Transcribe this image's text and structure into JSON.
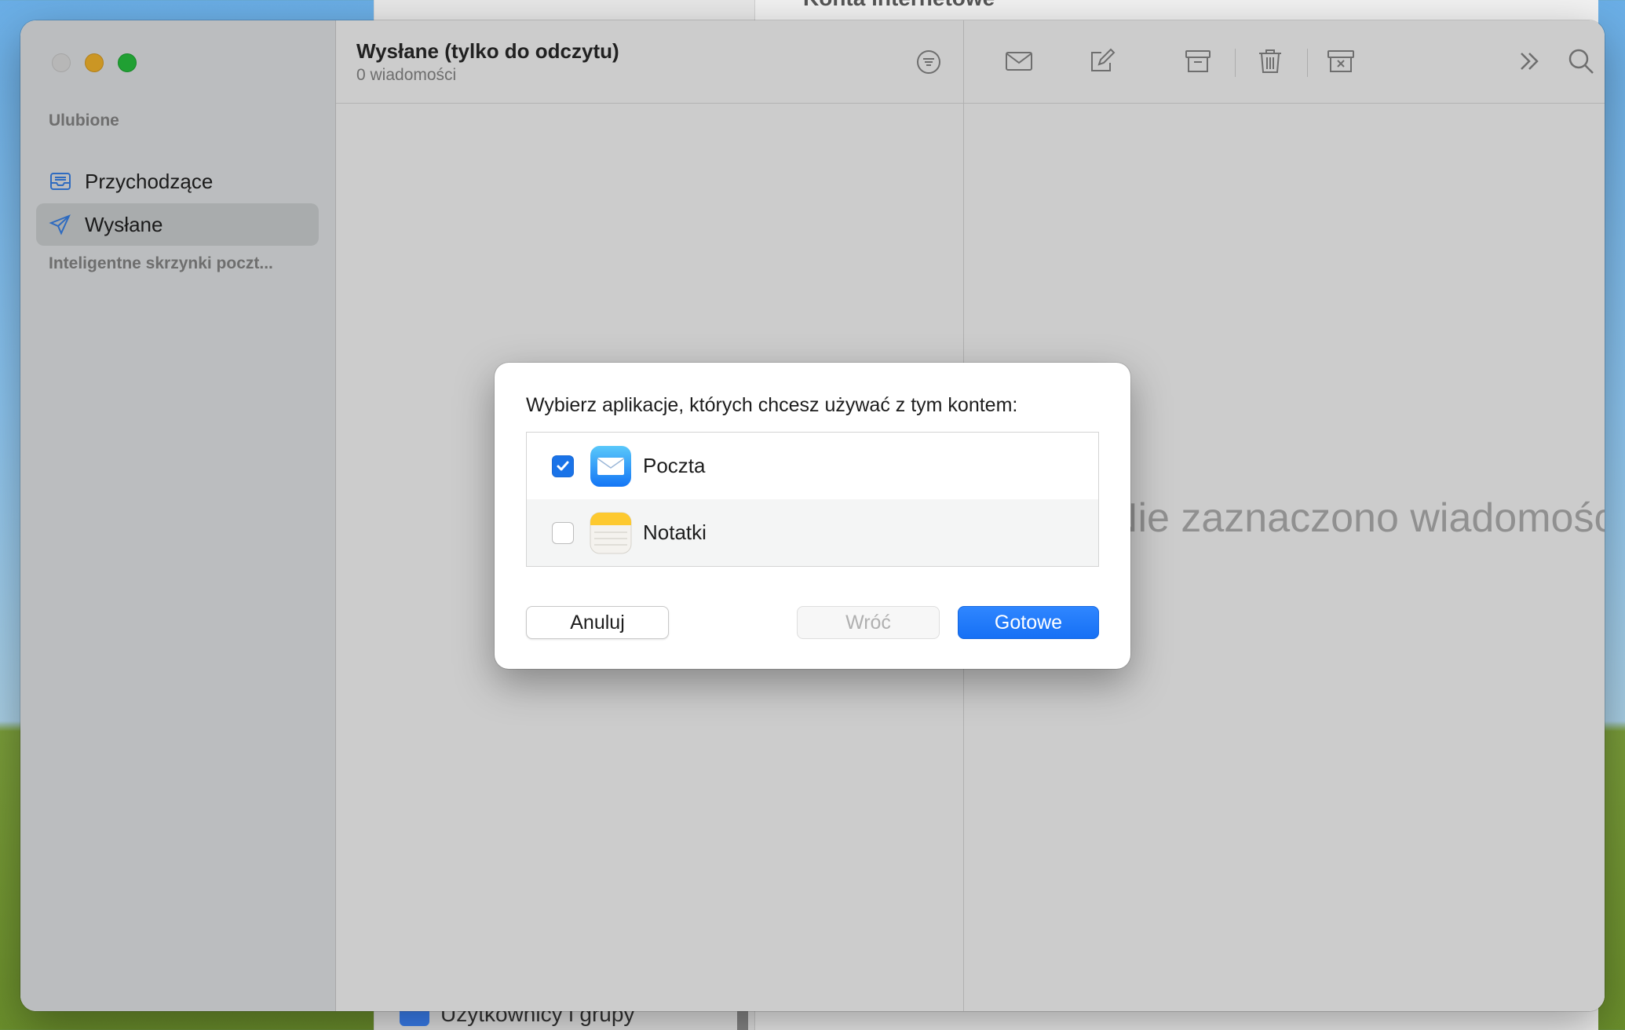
{
  "background_window": {
    "title": "Konta internetowe",
    "bottom_item": "Użytkownicy i grupy"
  },
  "sidebar": {
    "favorites_label": "Ulubione",
    "items": [
      {
        "label": "Przychodzące",
        "icon": "inbox-icon"
      },
      {
        "label": "Wysłane",
        "icon": "paper-plane-icon",
        "selected": true
      }
    ],
    "smart_mailboxes_label": "Inteligentne skrzynki poczt..."
  },
  "message_list": {
    "title": "Wysłane (tylko do odczytu)",
    "count": "0 wiadomości"
  },
  "detail": {
    "empty_text": "Nie zaznaczono wiadomości"
  },
  "toolbar": {
    "icons": [
      "envelope-icon",
      "compose-icon",
      "archive-icon",
      "trash-icon",
      "junk-icon",
      "more-chevrons-icon",
      "search-icon"
    ]
  },
  "dialog": {
    "prompt": "Wybierz aplikacje, których chcesz używać z tym kontem:",
    "apps": [
      {
        "name": "Poczta",
        "checked": true,
        "icon": "mail-app-icon"
      },
      {
        "name": "Notatki",
        "checked": false,
        "icon": "notes-app-icon"
      }
    ],
    "buttons": {
      "cancel": "Anuluj",
      "back": "Wróć",
      "done": "Gotowe"
    }
  },
  "colors": {
    "accent": "#1a73e8",
    "traffic_min": "#febc2e",
    "traffic_max": "#28c840"
  }
}
